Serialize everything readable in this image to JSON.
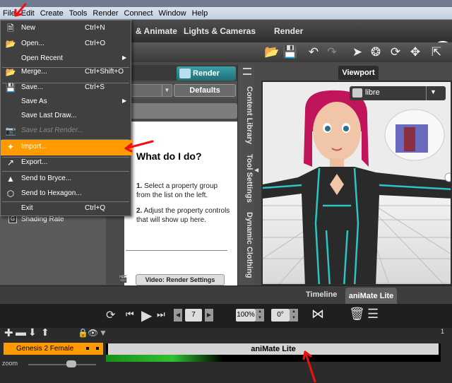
{
  "menubar": {
    "items": [
      "File",
      "Edit",
      "Create",
      "Tools",
      "Render",
      "Connect",
      "Window",
      "Help"
    ]
  },
  "main_tabs": [
    "& Animate",
    "Lights & Cameras",
    "Render"
  ],
  "file_menu": {
    "items": [
      {
        "label": "New",
        "shortcut": "Ctrl+N",
        "icon": "new-file-icon"
      },
      {
        "label": "Open...",
        "shortcut": "Ctrl+O",
        "icon": "open-folder-icon"
      },
      {
        "label": "Open Recent",
        "shortcut": "",
        "submenu": true
      },
      {
        "label": "Merge...",
        "shortcut": "Ctrl+Shift+O",
        "icon": "merge-icon"
      },
      {
        "label": "Save...",
        "shortcut": "Ctrl+S",
        "icon": "save-icon"
      },
      {
        "label": "Save As",
        "shortcut": "",
        "submenu": true
      },
      {
        "label": "Save Last Draw...",
        "shortcut": ""
      },
      {
        "label": "Save Last Render...",
        "shortcut": "",
        "disabled": true
      },
      {
        "label": "Import...",
        "shortcut": "",
        "highlighted": true
      },
      {
        "label": "Export...",
        "shortcut": ""
      },
      {
        "label": "Send to Bryce...",
        "shortcut": ""
      },
      {
        "label": "Send to Hexagon...",
        "shortcut": ""
      },
      {
        "label": "Exit",
        "shortcut": "Ctrl+Q"
      }
    ]
  },
  "render_panel": {
    "render_label": "Render",
    "defaults_label": "Defaults",
    "help_title": "What do I do?",
    "step1_num": "1.",
    "step1": "Select a property group from the list on the left.",
    "step2_num": "2.",
    "step2": "Adjust the property controls that will show up here.",
    "video_label": "Video: Render Settings"
  },
  "left_panel": {
    "shading_label": "Shading Rate"
  },
  "side_tabs": [
    "Content Library",
    "Tool Settings",
    "Dynamic Clothing"
  ],
  "viewport": {
    "tab_label": "Viewport",
    "camera": "libre"
  },
  "timeline": {
    "tabs": [
      "Timeline",
      "aniMate Lite"
    ],
    "frame": "7",
    "zoom_percent": "100%",
    "angle": "0°",
    "figure": "Genesis 2 Female",
    "track_title": "aniMate Lite",
    "zoom_label": "zoom",
    "ruler_mark": "1"
  },
  "colors": {
    "accent": "#ff9a00",
    "render_teal": "#1c6f78",
    "annotation_red": "#ee1111"
  }
}
